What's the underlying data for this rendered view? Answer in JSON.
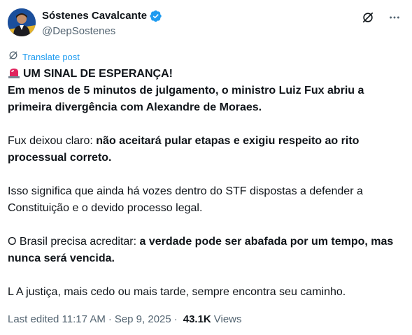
{
  "author": {
    "name": "Sóstenes Cavalcante",
    "handle": "@DepSostenes"
  },
  "translate_label": "Translate post",
  "tweet": {
    "p1_line1": "UM SINAL DE ESPERANÇA!",
    "p1_line2": "Em menos de 5 minutos de julgamento, o ministro Luiz Fux abriu a primeira divergência com Alexandre de Moraes.",
    "p2_normal": "Fux deixou claro: ",
    "p2_bold": "não aceitará pular etapas e exigiu respeito ao rito processual correto.",
    "p3": "Isso significa que ainda há vozes dentro do STF dispostas a defender a Constituição e o devido processo legal.",
    "p4_normal": "O Brasil precisa acreditar: ",
    "p4_bold": "a verdade pode ser abafada por um tempo, mas nunca será vencida.",
    "p5": "L A justiça, mais cedo ou mais tarde, sempre encontra seu caminho."
  },
  "meta": {
    "edited": "Last edited 11:17 AM",
    "separator": "·",
    "date": "Sep 9, 2025",
    "views_count": "43.1K",
    "views_label": "Views"
  },
  "icons": {
    "verified": "verified-badge-icon",
    "grok": "grok-icon",
    "more": "more-icon",
    "translate": "translate-icon",
    "siren": "siren-emoji"
  },
  "colors": {
    "link": "#1d9bf0",
    "verified": "#1d9bf0",
    "secondary_text": "#536471",
    "primary_text": "#0f1419"
  }
}
